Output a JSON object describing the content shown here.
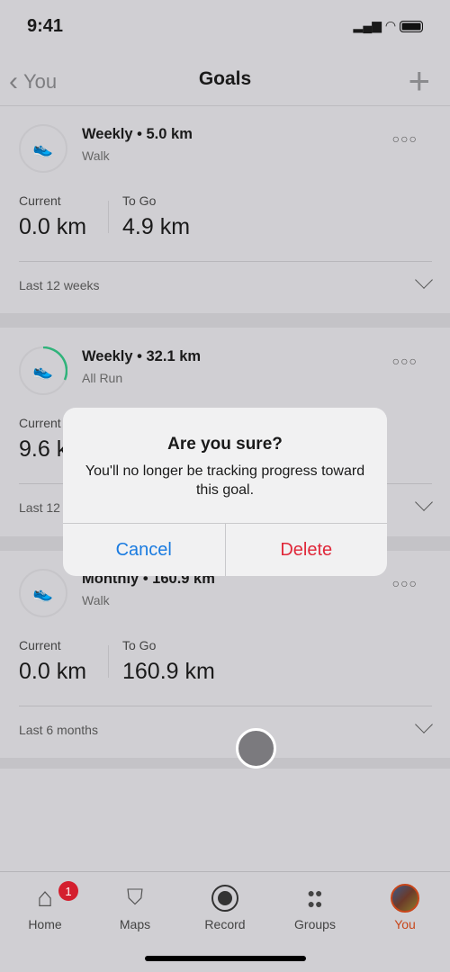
{
  "status": {
    "time": "9:41"
  },
  "nav": {
    "back": "You",
    "title": "Goals",
    "add": "+"
  },
  "goals": [
    {
      "title": "Weekly • 5.0 km",
      "sport": "Walk",
      "current_label": "Current",
      "current": "0.0 km",
      "togo_label": "To Go",
      "togo": "4.9 km",
      "range": "Last 12 weeks",
      "progress": 0
    },
    {
      "title": "Weekly • 32.1 km",
      "sport": "All Run",
      "current_label": "Current",
      "current": "9.6 km",
      "range": "Last 12 weeks",
      "progress": 0.3
    },
    {
      "title": "Monthly • 160.9 km",
      "sport": "Walk",
      "current_label": "Current",
      "current": "0.0 km",
      "togo_label": "To Go",
      "togo": "160.9 km",
      "range": "Last 6 months",
      "progress": 0
    }
  ],
  "dialog": {
    "title": "Are you sure?",
    "message": "You'll no longer be tracking progress toward this goal.",
    "cancel": "Cancel",
    "delete": "Delete"
  },
  "tabs": [
    {
      "label": "Home",
      "badge": "1"
    },
    {
      "label": "Maps"
    },
    {
      "label": "Record"
    },
    {
      "label": "Groups"
    },
    {
      "label": "You"
    }
  ],
  "colors": {
    "accent": "#c8461a",
    "delete": "#e0283a",
    "cancel": "#1a7be0",
    "progress": "#2fb37a",
    "badge": "#d41f2e"
  }
}
